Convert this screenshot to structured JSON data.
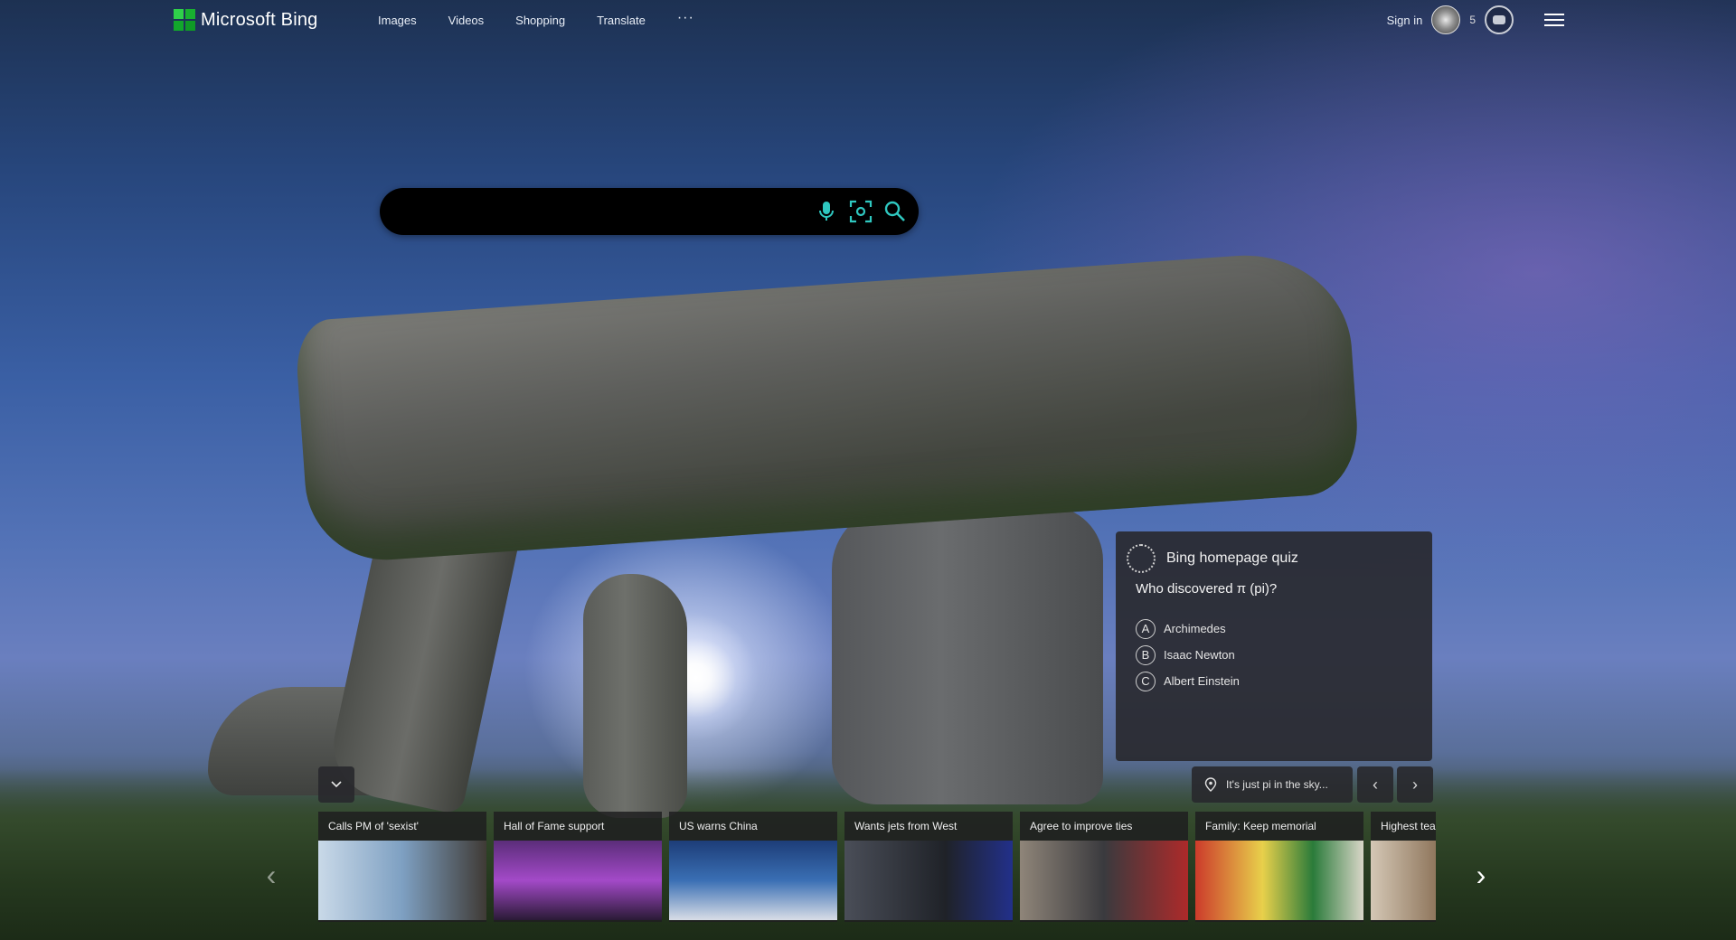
{
  "header": {
    "logo_text": "Microsoft Bing",
    "nav": [
      "Images",
      "Videos",
      "Shopping",
      "Translate"
    ],
    "more_label": "···",
    "sign_in": "Sign in",
    "rewards_count": "5"
  },
  "search": {
    "placeholder": "",
    "value": ""
  },
  "quiz": {
    "title": "Bing homepage quiz",
    "question": "Who discovered π (pi)?",
    "options": [
      {
        "letter": "A",
        "text": "Archimedes"
      },
      {
        "letter": "B",
        "text": "Isaac Newton"
      },
      {
        "letter": "C",
        "text": "Albert Einstein"
      }
    ]
  },
  "image_info": {
    "caption": "It's just pi in the sky..."
  },
  "news": [
    {
      "title": "Calls PM of 'sexist'"
    },
    {
      "title": "Hall of Fame support"
    },
    {
      "title": "US warns China"
    },
    {
      "title": "Wants jets from West"
    },
    {
      "title": "Agree to improve ties"
    },
    {
      "title": "Family: Keep memorial"
    },
    {
      "title": "Highest tea"
    }
  ],
  "colors": {
    "logo_green": "#1fbf3a",
    "panel_bg": "#28282c",
    "search_bg": "#000000"
  }
}
